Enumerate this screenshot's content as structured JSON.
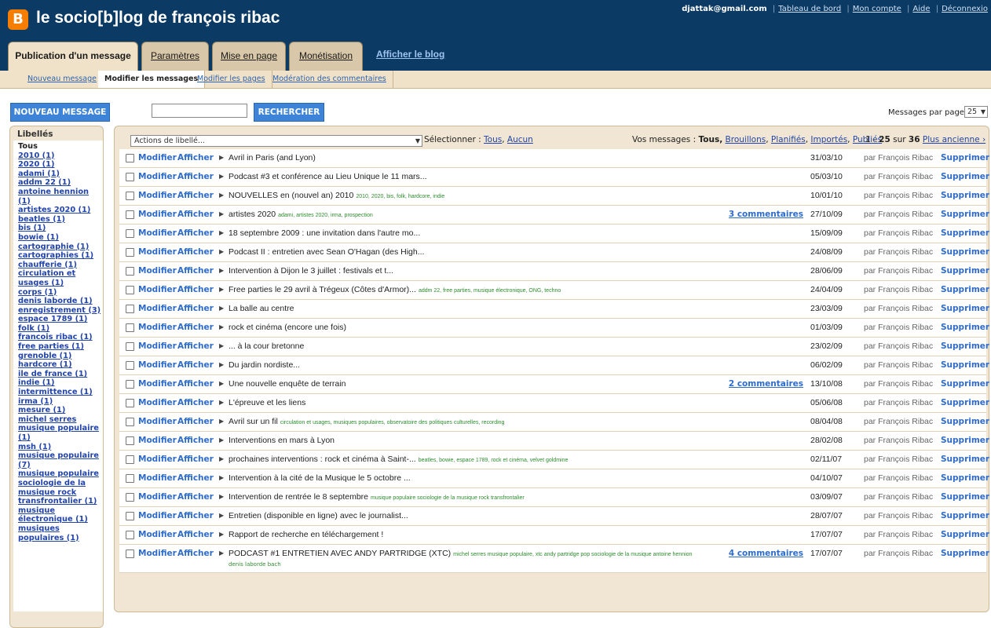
{
  "header": {
    "logo_letter": "B",
    "blog_title": "le socio[b]log de françois ribac",
    "user_email": "djattak@gmail.com",
    "links": [
      "Tableau de bord",
      "Mon compte",
      "Aide",
      "Déconnexio"
    ]
  },
  "main_tabs": [
    "Publication d'un message",
    "Paramètres",
    "Mise en page",
    "Monétisation"
  ],
  "view_blog": "Afficher le blog",
  "sub_tabs": [
    "Nouveau message",
    "Modifier les messages",
    "Modifier les pages",
    "Modération des commentaires"
  ],
  "toolbar": {
    "new_post": "NOUVEAU MESSAGE",
    "search_value": "",
    "search_button": "RECHERCHER",
    "per_page_label": "Messages par page",
    "per_page_value": "25"
  },
  "sidebar": {
    "title": "Libellés",
    "labels": [
      "Tous",
      "2010 (1)",
      "2020 (1)",
      "adami (1)",
      "addm 22 (1)",
      "antoine hennion (1)",
      "artistes 2020 (1)",
      "beatles (1)",
      "bis (1)",
      "bowie (1)",
      "cartographie (1)",
      "cartographies (1)",
      "chaufferie (1)",
      "circulation et usages (1)",
      "corps (1)",
      "denis laborde (1)",
      "enregistrement (3)",
      "espace 1789 (1)",
      "folk (1)",
      "francois ribac (1)",
      "free parties (1)",
      "grenoble (1)",
      "hardcore (1)",
      "ile de france (1)",
      "indie (1)",
      "intermittence (1)",
      "irma (1)",
      "mesure (1)",
      "michel serres musique populaire (1)",
      "msh (1)",
      "musique populaire (7)",
      "musique populaire sociologie de la musique rock transfrontalier (1)",
      "musique électronique (1)",
      "musiques populaires (1)"
    ]
  },
  "list_controls": {
    "actions_placeholder": "Actions de libellé...",
    "select_label": "Sélectionner :",
    "select_all": "Tous",
    "select_none": "Aucun",
    "filter_label": "Vos messages :",
    "filter_all": "Tous,",
    "filters": [
      "Brouillons",
      "Planifiés",
      "Importés",
      "Publiés"
    ],
    "paging_range_start": "1",
    "paging_range_end": "25",
    "paging_on": "sur",
    "paging_total": "36",
    "paging_older": "Plus ancienne ›"
  },
  "row_actions": {
    "edit": "Modifier",
    "view": "Afficher",
    "delete": "Supprimer"
  },
  "posts": [
    {
      "title": "Avril in Paris (and Lyon)",
      "tags": "",
      "comments": "",
      "date": "31/03/10",
      "author": "par François Ribac"
    },
    {
      "title": "Podcast #3 et conférence au Lieu Unique le 11 mars...",
      "tags": "",
      "comments": "",
      "date": "05/03/10",
      "author": "par François Ribac"
    },
    {
      "title": "NOUVELLES en (nouvel an) 2010",
      "tags": "2010, 2020, bis, folk, hardcore, indie",
      "comments": "",
      "date": "10/01/10",
      "author": "par François Ribac"
    },
    {
      "title": "artistes 2020",
      "tags": "adami, artistes 2020, irma, prospection",
      "comments": "3 commentaires",
      "date": "27/10/09",
      "author": "par François Ribac"
    },
    {
      "title": "18 septembre 2009 : une invitation dans l'autre mo...",
      "tags": "",
      "comments": "",
      "date": "15/09/09",
      "author": "par François Ribac"
    },
    {
      "title": "Podcast II : entretien avec Sean O'Hagan (des High...",
      "tags": "",
      "comments": "",
      "date": "24/08/09",
      "author": "par François Ribac"
    },
    {
      "title": "Intervention à Dijon le 3 juillet : festivals et t...",
      "tags": "",
      "comments": "",
      "date": "28/06/09",
      "author": "par François Ribac"
    },
    {
      "title": "Free parties le 29 avril à Trégeux (Côtes d'Armor)...",
      "tags": "addm 22, free parties, musique électronique, ONG, techno",
      "comments": "",
      "date": "24/04/09",
      "author": "par François Ribac"
    },
    {
      "title": "La balle au centre",
      "tags": "",
      "comments": "",
      "date": "23/03/09",
      "author": "par François Ribac"
    },
    {
      "title": "rock et cinéma (encore une fois)",
      "tags": "",
      "comments": "",
      "date": "01/03/09",
      "author": "par François Ribac"
    },
    {
      "title": "... à la cour bretonne",
      "tags": "",
      "comments": "",
      "date": "23/02/09",
      "author": "par François Ribac"
    },
    {
      "title": "Du jardin nordiste...",
      "tags": "",
      "comments": "",
      "date": "06/02/09",
      "author": "par François Ribac"
    },
    {
      "title": "Une nouvelle enquête de terrain",
      "tags": "",
      "comments": "2 commentaires",
      "date": "13/10/08",
      "author": "par François Ribac"
    },
    {
      "title": "L'épreuve et les liens",
      "tags": "",
      "comments": "",
      "date": "05/06/08",
      "author": "par François Ribac"
    },
    {
      "title": "Avril sur un fil",
      "tags": "circulation et usages, musiques populaires, observatoire des politiques culturelles, recording",
      "comments": "",
      "date": "08/04/08",
      "author": "par François Ribac"
    },
    {
      "title": "Interventions en mars à Lyon",
      "tags": "",
      "comments": "",
      "date": "28/02/08",
      "author": "par François Ribac"
    },
    {
      "title": "prochaines interventions : rock et cinéma à Saint-...",
      "tags": "beatles, bowie, espace 1789, rock et cinéma, velvet goldmine",
      "comments": "",
      "date": "02/11/07",
      "author": "par François Ribac"
    },
    {
      "title": "Intervention à la cité de la Musique le 5 octobre ...",
      "tags": "",
      "comments": "",
      "date": "04/10/07",
      "author": "par François Ribac"
    },
    {
      "title": "Intervention de rentrée le 8 septembre",
      "tags": "musique populaire sociologie de la musique rock transfrontalier",
      "comments": "",
      "date": "03/09/07",
      "author": "par François Ribac"
    },
    {
      "title": "Entretien (disponible en ligne) avec le journalist...",
      "tags": "",
      "comments": "",
      "date": "28/07/07",
      "author": "par François Ribac"
    },
    {
      "title": "Rapport de recherche en téléchargement !",
      "tags": "",
      "comments": "",
      "date": "17/07/07",
      "author": "par François Ribac"
    },
    {
      "title": "PODCAST #1 ENTRETIEN AVEC ANDY PARTRIDGE (XTC)",
      "tags": "michel serres musique populaire, xtc andy partridge pop sociologie de la musique antoine hennion",
      "tags_line2": "denis laborde bach",
      "comments": "4 commentaires",
      "date": "17/07/07",
      "author": "par François Ribac"
    }
  ]
}
